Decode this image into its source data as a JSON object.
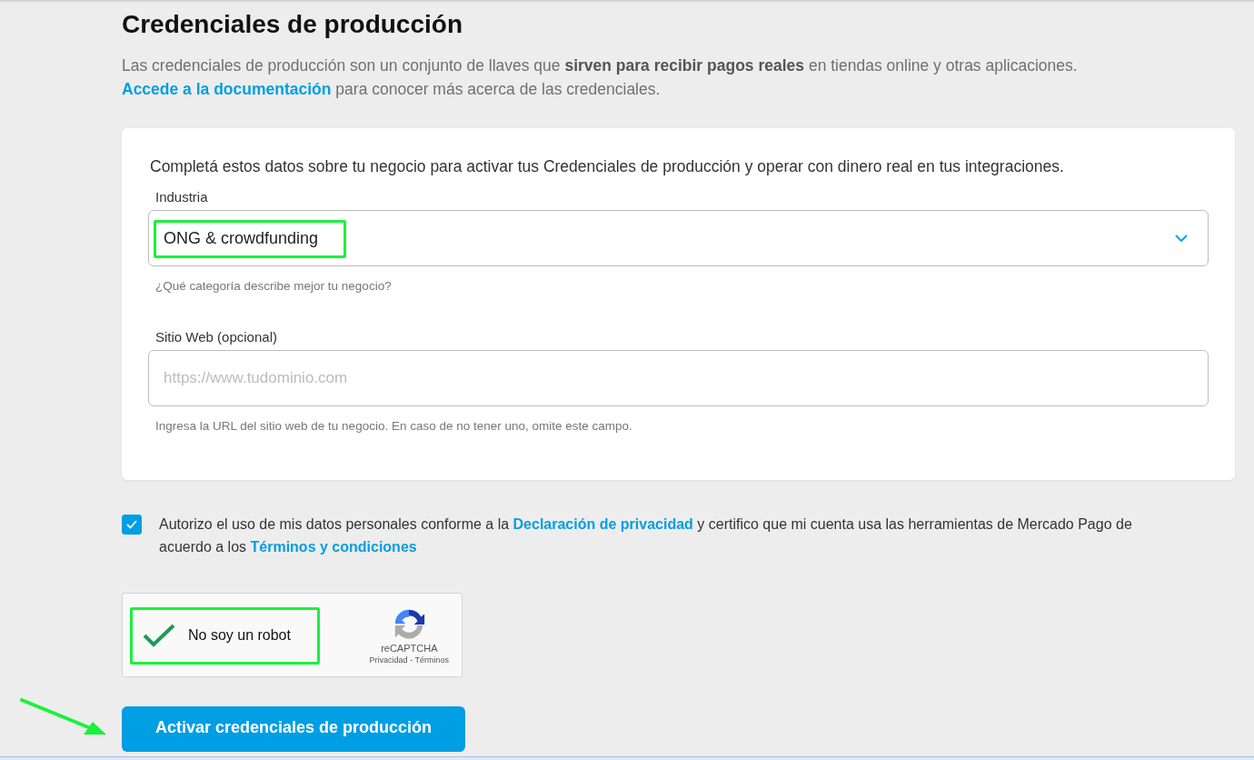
{
  "title": "Credenciales de producción",
  "intro": {
    "text": "Las credenciales de producción son un conjunto de llaves que **sirven para recibir pagos reales** en tiendas online y otras aplicaciones.",
    "link": "Accede a la documentación",
    "after": "para conocer más acerca de las credenciales."
  },
  "form": {
    "lead": "Completá estos datos sobre tu negocio para activar tus Credenciales de producción y operar con dinero real en tus integraciones.",
    "fields": [
      {
        "kind": "select",
        "label": "Industria",
        "value": "ONG & crowdfunding",
        "hint": "¿Qué categoría describe mejor tu negocio?",
        "highlighted": true
      },
      {
        "kind": "text",
        "label": "Sitio Web (opcional)",
        "placeholder": "https://www.tudominio.com",
        "hint": "Ingresa la URL del sitio web de tu negocio. En caso de no tener uno, omite este campo.",
        "highlighted": false
      }
    ]
  },
  "consent": {
    "checked": true,
    "parts": [
      {
        "kind": "text",
        "text": "Autorizo el uso de mis datos personales conforme a la"
      },
      {
        "kind": "link",
        "text": "Declaración de privacidad"
      },
      {
        "kind": "text",
        "text": "y certifico que mi cuenta usa las herramientas de Mercado Pago de acuerdo a los"
      },
      {
        "kind": "link",
        "text": "Términos y condiciones"
      }
    ]
  },
  "captcha": {
    "checked": true,
    "label": "No soy un robot",
    "brand": "reCAPTCHA",
    "privacy": "Privacidad",
    "separator": "-",
    "terms": "Términos",
    "highlighted": true
  },
  "submit": "Activar credenciales de producción"
}
